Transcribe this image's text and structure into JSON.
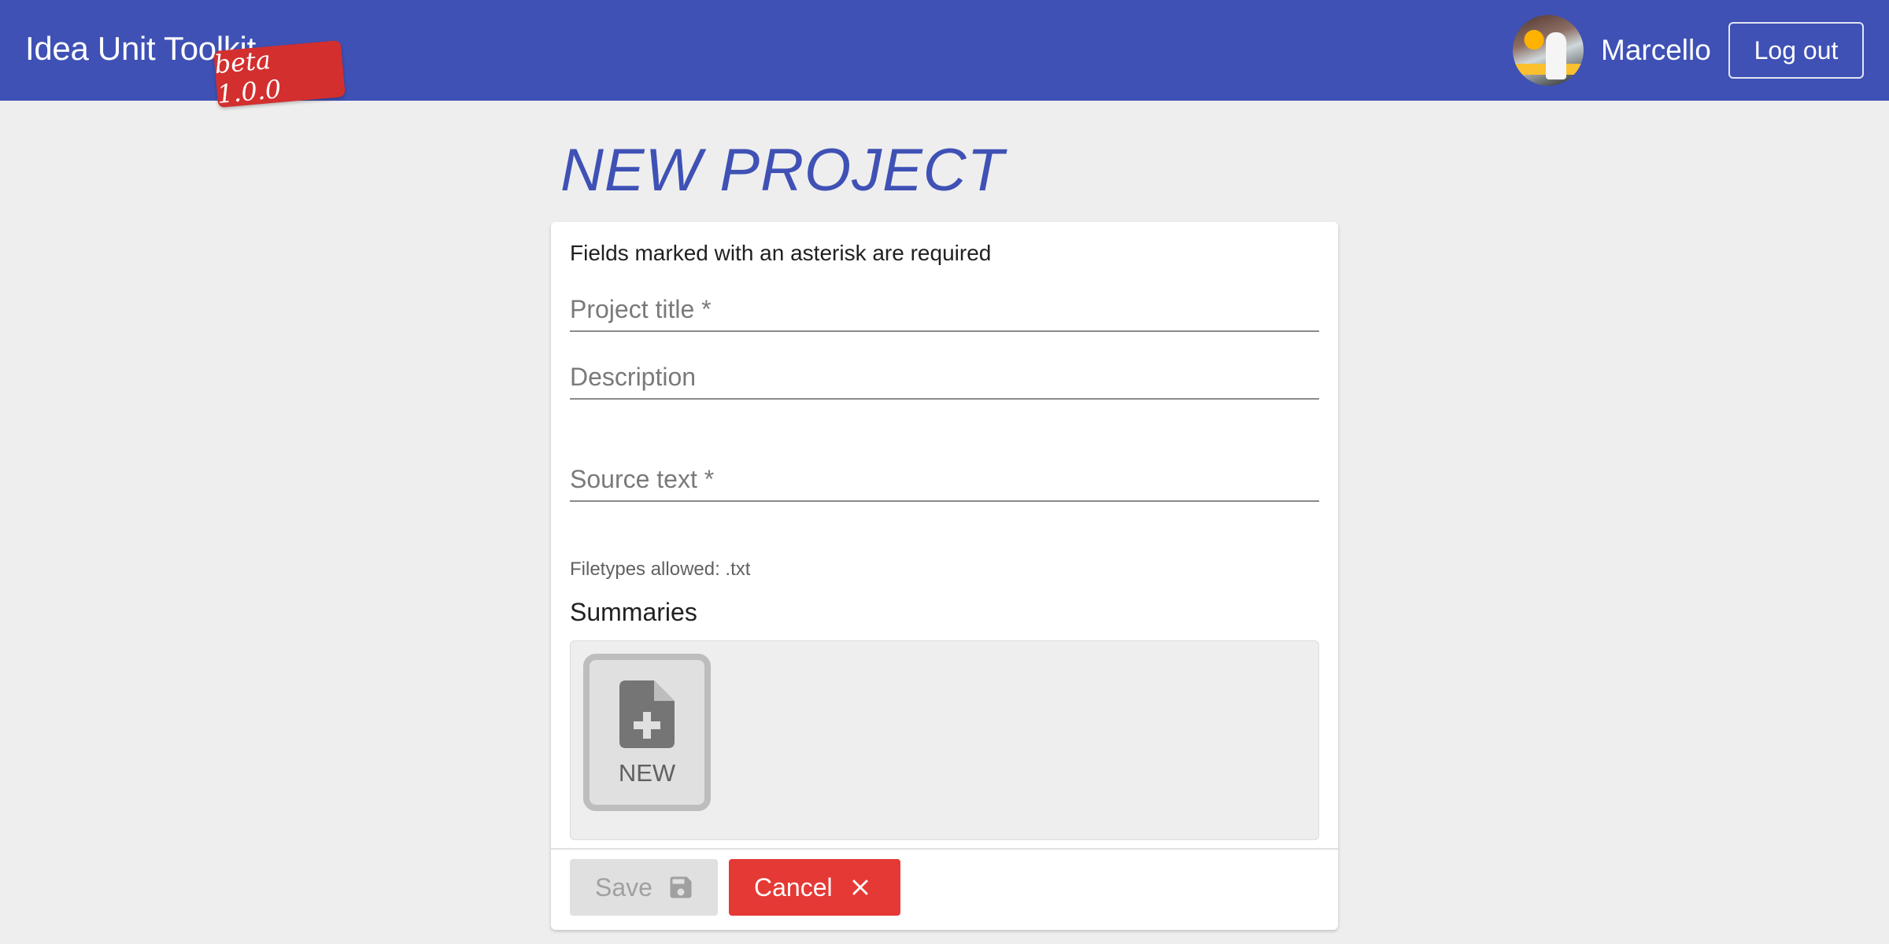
{
  "header": {
    "app_title": "Idea Unit Toolkit",
    "version_badge": "beta 1.0.0",
    "user_name": "Marcello",
    "logout_label": "Log out",
    "brand_color": "#3f51b5",
    "badge_color": "#d32f2f"
  },
  "page": {
    "title": "NEW PROJECT"
  },
  "form": {
    "required_note": "Fields marked with an asterisk are required",
    "project_title_placeholder": "Project title *",
    "description_placeholder": "Description",
    "source_text_placeholder": "Source text *",
    "source_text_hint": "Filetypes allowed: .txt",
    "summaries_label": "Summaries",
    "new_summary_label": "NEW",
    "new_summary_icon": "file-plus-icon"
  },
  "actions": {
    "save_label": "Save",
    "save_icon": "floppy-disk-icon",
    "save_enabled": false,
    "cancel_label": "Cancel",
    "cancel_icon": "close-icon",
    "cancel_color": "#e53935"
  }
}
